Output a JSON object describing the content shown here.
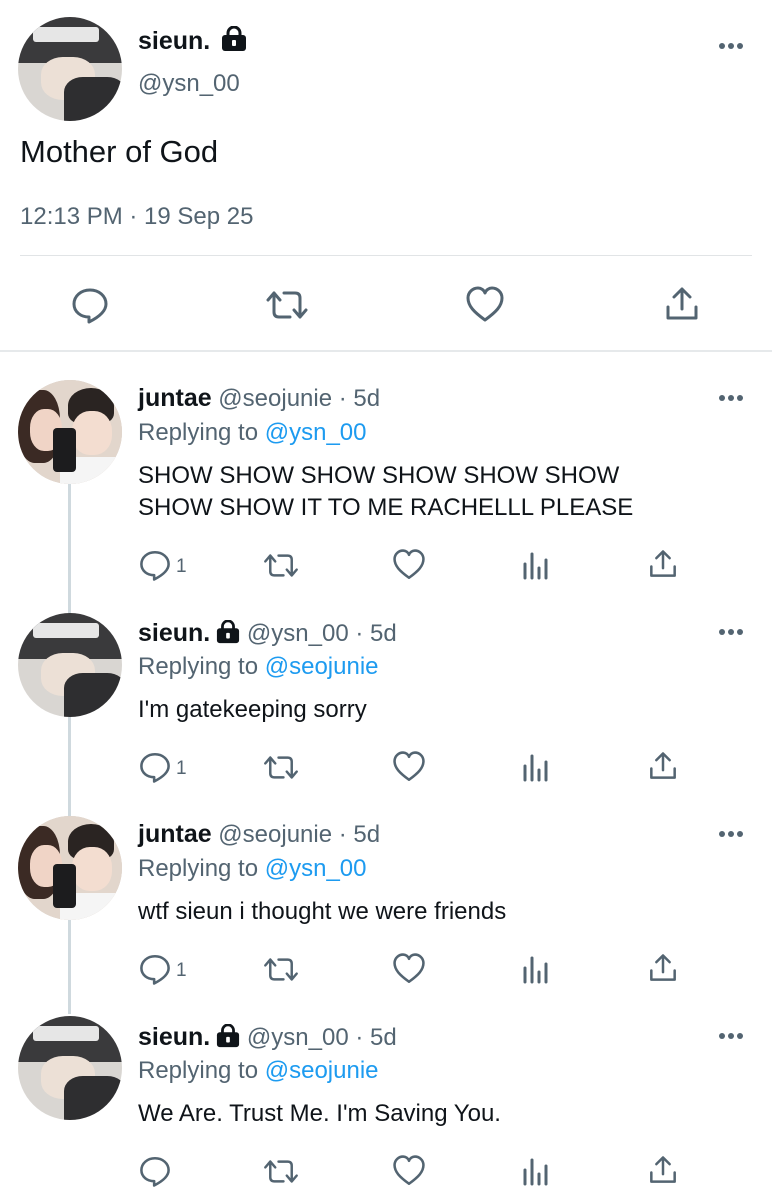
{
  "main_tweet": {
    "name": "sieun.",
    "handle": "@ysn_00",
    "text": "Mother of God",
    "timestamp": "12:13 PM · 19 Sep 25"
  },
  "replies": [
    {
      "name": "juntae",
      "handle": "@seojunie",
      "time": "5d",
      "replying_label": "Replying to",
      "replying_to": "@ysn_00",
      "text": "SHOW SHOW SHOW SHOW SHOW SHOW\nSHOW SHOW IT TO ME RACHELLL PLEASE",
      "reply_count": "1"
    },
    {
      "name": "sieun.",
      "handle": "@ysn_00",
      "time": "5d",
      "replying_label": "Replying to",
      "replying_to": "@seojunie",
      "text": "I'm gatekeeping sorry",
      "reply_count": "1"
    },
    {
      "name": "juntae",
      "handle": "@seojunie",
      "time": "5d",
      "replying_label": "Replying to",
      "replying_to": "@ysn_00",
      "text": "wtf sieun i thought we were friends",
      "reply_count": "1"
    },
    {
      "name": "sieun.",
      "handle": "@ysn_00",
      "time": "5d",
      "replying_label": "Replying to",
      "replying_to": "@seojunie",
      "text": "We Are. Trust Me. I'm Saving You.",
      "reply_count": ""
    }
  ],
  "separator": " · ",
  "icons": [
    "reply-icon",
    "retweet-icon",
    "like-icon",
    "share-icon",
    "analytics-icon",
    "more-icon",
    "lock-icon"
  ],
  "colors": {
    "link": "#1d9bf0",
    "secondary_text": "#536471",
    "primary_text": "#0f1419"
  }
}
